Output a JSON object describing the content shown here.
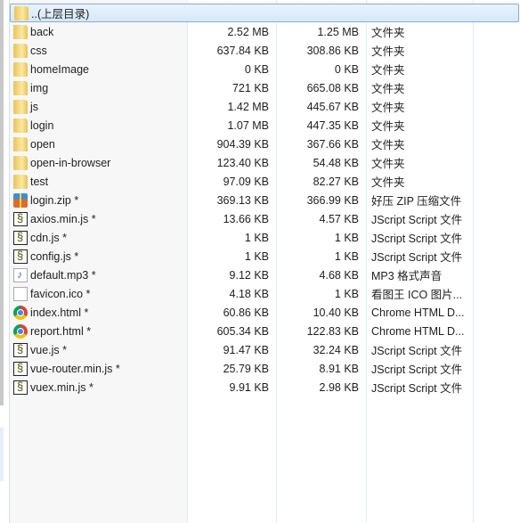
{
  "parent_row": {
    "name": "..(上层目录)",
    "icon": "folder-icon"
  },
  "files": [
    {
      "name": "back",
      "size": "2.52 MB",
      "packed": "1.25 MB",
      "type": "文件夹",
      "icon": "folder"
    },
    {
      "name": "css",
      "size": "637.84 KB",
      "packed": "308.86 KB",
      "type": "文件夹",
      "icon": "folder"
    },
    {
      "name": "homeImage",
      "size": "0 KB",
      "packed": "0 KB",
      "type": "文件夹",
      "icon": "folder"
    },
    {
      "name": "img",
      "size": "721 KB",
      "packed": "665.08 KB",
      "type": "文件夹",
      "icon": "folder"
    },
    {
      "name": "js",
      "size": "1.42 MB",
      "packed": "445.67 KB",
      "type": "文件夹",
      "icon": "folder"
    },
    {
      "name": "login",
      "size": "1.07 MB",
      "packed": "447.35 KB",
      "type": "文件夹",
      "icon": "folder"
    },
    {
      "name": "open",
      "size": "904.39 KB",
      "packed": "367.66 KB",
      "type": "文件夹",
      "icon": "folder"
    },
    {
      "name": "open-in-browser",
      "size": "123.40 KB",
      "packed": "54.48 KB",
      "type": "文件夹",
      "icon": "folder"
    },
    {
      "name": "test",
      "size": "97.09 KB",
      "packed": "82.27 KB",
      "type": "文件夹",
      "icon": "folder"
    },
    {
      "name": "login.zip *",
      "size": "369.13 KB",
      "packed": "366.99 KB",
      "type": "好压 ZIP 压缩文件",
      "icon": "zip"
    },
    {
      "name": "axios.min.js *",
      "size": "13.66 KB",
      "packed": "4.57 KB",
      "type": "JScript Script 文件",
      "icon": "js"
    },
    {
      "name": "cdn.js *",
      "size": "1 KB",
      "packed": "1 KB",
      "type": "JScript Script 文件",
      "icon": "js"
    },
    {
      "name": "config.js *",
      "size": "1 KB",
      "packed": "1 KB",
      "type": "JScript Script 文件",
      "icon": "js"
    },
    {
      "name": "default.mp3 *",
      "size": "9.12 KB",
      "packed": "4.68 KB",
      "type": "MP3 格式声音",
      "icon": "mp3"
    },
    {
      "name": "favicon.ico *",
      "size": "4.18 KB",
      "packed": "1 KB",
      "type": "看图王 ICO 图片...",
      "icon": "ico"
    },
    {
      "name": "index.html *",
      "size": "60.86 KB",
      "packed": "10.40 KB",
      "type": "Chrome HTML D...",
      "icon": "chrome"
    },
    {
      "name": "report.html *",
      "size": "605.34 KB",
      "packed": "122.83 KB",
      "type": "Chrome HTML D...",
      "icon": "chrome"
    },
    {
      "name": "vue.js *",
      "size": "91.47 KB",
      "packed": "32.24 KB",
      "type": "JScript Script 文件",
      "icon": "js"
    },
    {
      "name": "vue-router.min.js *",
      "size": "25.79 KB",
      "packed": "8.91 KB",
      "type": "JScript Script 文件",
      "icon": "js"
    },
    {
      "name": "vuex.min.js *",
      "size": "9.91 KB",
      "packed": "2.98 KB",
      "type": "JScript Script 文件",
      "icon": "js"
    }
  ]
}
